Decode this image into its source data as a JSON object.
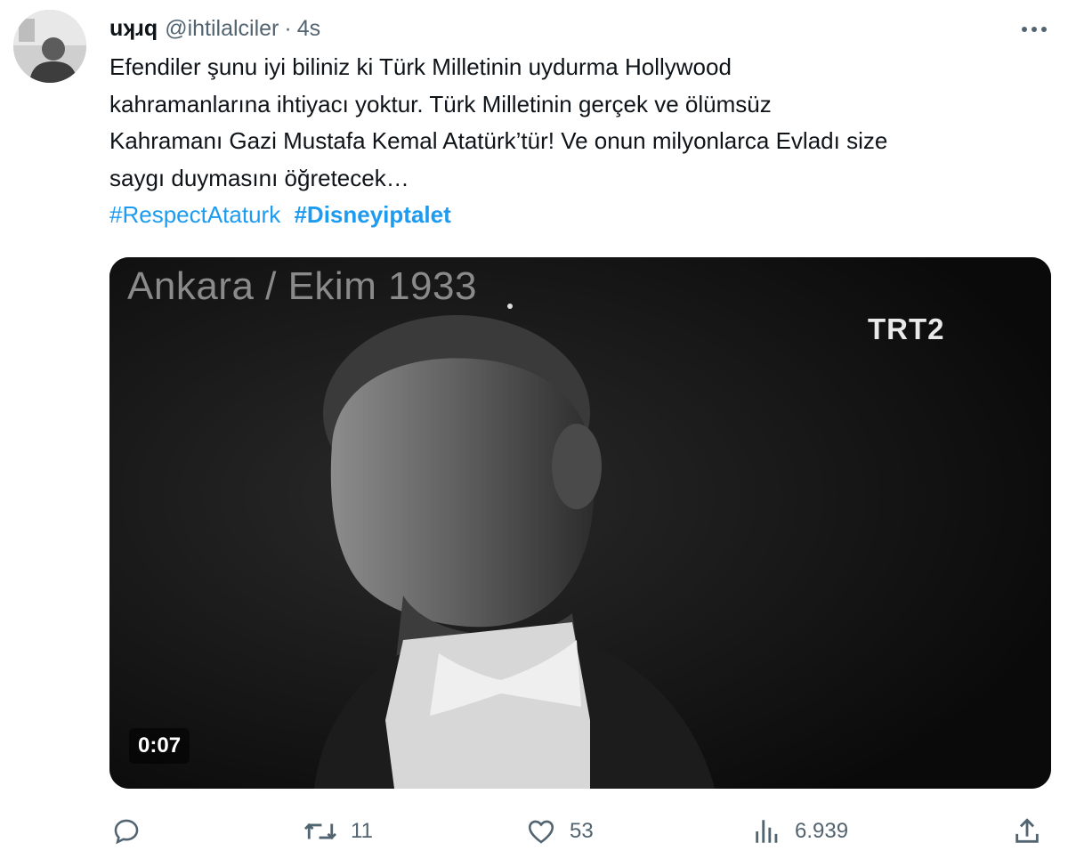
{
  "tweet": {
    "display_name": "uʞɹq",
    "handle": "@ihtilalciler",
    "separator": "·",
    "time": "4s",
    "text_lines": [
      "Efendiler şunu iyi biliniz ki Türk Milletinin uydurma Hollywood",
      "kahramanlarına ihtiyacı yoktur. Türk Milletinin gerçek ve ölümsüz",
      "Kahramanı Gazi Mustafa Kemal Atatürk’tür! Ve onun milyonlarca Evladı size",
      "saygı duymasını öğretecek…"
    ],
    "hashtags": [
      "#RespectAtaturk",
      "#Disneyiptalet"
    ]
  },
  "media": {
    "caption": "Ankara / Ekim 1933",
    "logo": "TRT2",
    "duration": "0:07"
  },
  "actions": {
    "reply": {
      "icon": "reply-icon",
      "count": ""
    },
    "retweet": {
      "icon": "retweet-icon",
      "count": "11"
    },
    "like": {
      "icon": "heart-icon",
      "count": "53"
    },
    "views": {
      "icon": "views-chart-icon",
      "count": "6.939"
    },
    "share": {
      "icon": "share-icon",
      "count": ""
    }
  },
  "colors": {
    "link": "#1d9bf0",
    "secondary_text": "#536471",
    "primary_text": "#0f1419"
  }
}
